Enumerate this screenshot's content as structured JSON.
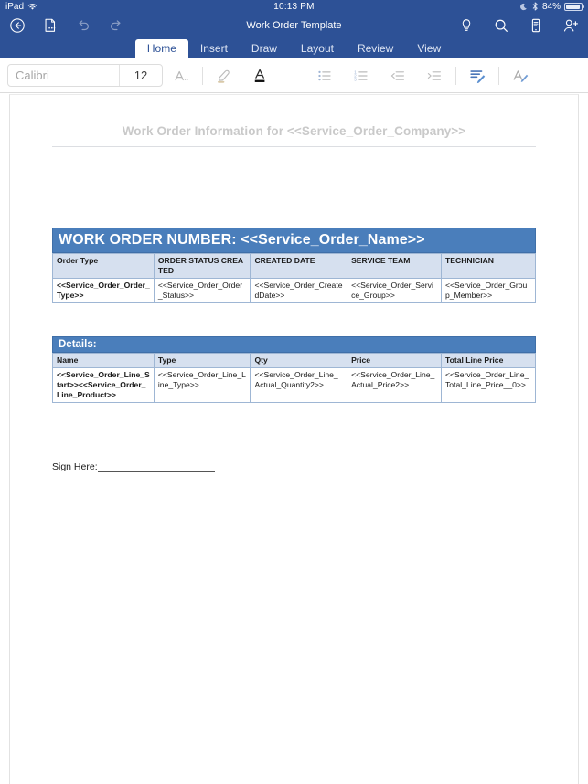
{
  "statusbar": {
    "device": "iPad",
    "wifi_icon": "wifi-icon",
    "time": "10:13 PM",
    "dnd_icon": "moon-icon",
    "bluetooth_icon": "bluetooth-icon",
    "battery_percent": "84%",
    "battery_icon": "battery-icon"
  },
  "toolbar": {
    "back_icon": "back-circle-icon",
    "file_icon": "file-options-icon",
    "undo_icon": "undo-icon",
    "redo_icon": "redo-icon",
    "title": "Work Order Template",
    "tellme_icon": "lightbulb-icon",
    "search_icon": "search-icon",
    "mobileview_icon": "mobile-view-icon",
    "share_icon": "add-person-icon"
  },
  "tabs": [
    {
      "label": "Home",
      "active": true
    },
    {
      "label": "Insert",
      "active": false
    },
    {
      "label": "Draw",
      "active": false
    },
    {
      "label": "Layout",
      "active": false
    },
    {
      "label": "Review",
      "active": false
    },
    {
      "label": "View",
      "active": false
    }
  ],
  "ribbon": {
    "font_name": "Calibri",
    "font_name_placeholder": "Calibri",
    "font_size": "12",
    "buttons": [
      {
        "name": "format-text-icon"
      },
      {
        "name": "highlighter-icon"
      },
      {
        "name": "font-color-icon"
      },
      {
        "name": "bulleted-list-icon"
      },
      {
        "name": "numbered-list-icon"
      },
      {
        "name": "decrease-indent-icon"
      },
      {
        "name": "increase-indent-icon"
      },
      {
        "name": "paragraph-styles-icon"
      },
      {
        "name": "text-styles-icon"
      }
    ]
  },
  "document": {
    "header_text": "Work Order Information for <<Service_Order_Company>>",
    "work_order": {
      "banner": "WORK ORDER NUMBER: <<Service_Order_Name>>",
      "columns": [
        "Order Type",
        "ORDER STATUS CREATED",
        "CREATED DATE",
        "SERVICE TEAM",
        "TECHNICIAN"
      ],
      "rows": [
        [
          "<<Service_Order_Order_Type>>",
          "<<Service_Order_Order_Status>>",
          "<<Service_Order_CreatedDate>>",
          "<<Service_Order_Service_Group>>",
          "<<Service_Order_Group_Member>>"
        ]
      ]
    },
    "details": {
      "banner": "Details:",
      "columns": [
        "Name",
        "Type",
        "Qty",
        "Price",
        "Total Line Price"
      ],
      "rows": [
        [
          "<<Service_Order_Line_Start>><<Service_Order_Line_Product>>",
          "<<Service_Order_Line_Line_Type>>",
          "<<Service_Order_Line_Actual_Quantity2>>",
          "<<Service_Order_Line_Actual_Price2>>",
          "<<Service_Order_Line_Total_Line_Price__0>>"
        ]
      ]
    },
    "sign_label": "Sign Here:"
  },
  "colors": {
    "chrome_blue": "#2d5196",
    "banner_blue": "#4a7ebb",
    "table_header_blue": "#d6e0ef",
    "table_border": "#9eb6d4"
  }
}
